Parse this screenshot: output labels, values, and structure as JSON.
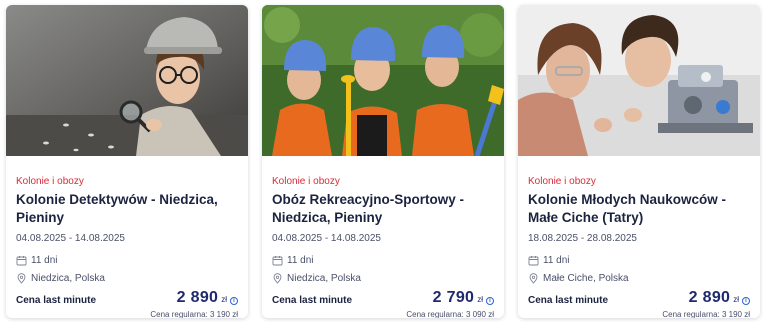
{
  "cards": [
    {
      "category": "Kolonie i obozy",
      "title": "Kolonie Detektywów - Niedzica, Pieniny",
      "dates": "04.08.2025 - 14.08.2025",
      "duration": "11 dni",
      "location": "Niedzica, Polska",
      "price_label": "Cena last minute",
      "price": "2 890",
      "currency": "zł",
      "regular_price": "Cena regularna: 3 190 zł",
      "image": "boy-detective-with-magnifying-glass"
    },
    {
      "category": "Kolonie i obozy",
      "title": "Obóz Rekreacyjno-Sportowy - Niedzica, Pieniny",
      "dates": "04.08.2025 - 14.08.2025",
      "duration": "11 dni",
      "location": "Niedzica, Polska",
      "price_label": "Cena last minute",
      "price": "2 790",
      "currency": "zł",
      "regular_price": "Cena regularna: 3 090 zł",
      "image": "girls-in-rafting-helmets"
    },
    {
      "category": "Kolonie i obozy",
      "title": "Kolonie Młodych Naukowców - Małe Ciche (Tatry)",
      "dates": "18.08.2025 - 28.08.2025",
      "duration": "11 dni",
      "location": "Małe Ciche, Polska",
      "price_label": "Cena last minute",
      "price": "2 890",
      "currency": "zł",
      "regular_price": "Cena regularna: 3 190 zł",
      "image": "kids-building-robot"
    }
  ],
  "colors": {
    "category": "#d62b3a",
    "title": "#1c2340",
    "price": "#1f2a6e",
    "info": "#2b63d6"
  },
  "icons": {
    "duration": "calendar-icon",
    "location": "map-pin-icon",
    "price_info": "info-icon"
  }
}
